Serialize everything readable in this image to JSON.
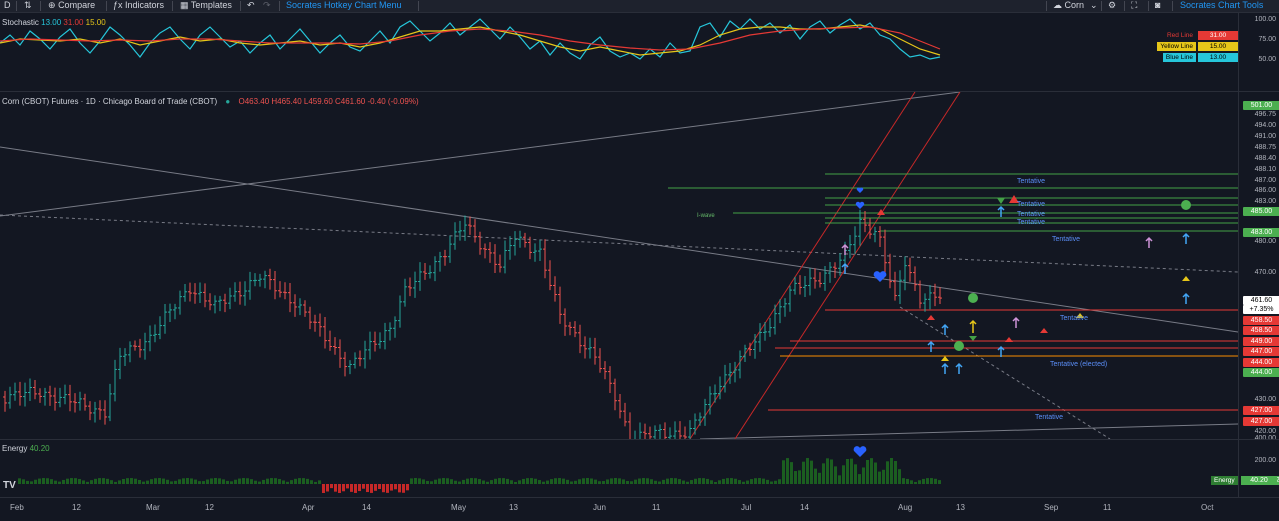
{
  "toolbar": {
    "symbol_partial": "D",
    "compare": "Compare",
    "indicators": "Indicators",
    "templates": "Templates",
    "hotkey_menu": "Socrates Hotkey Chart Menu",
    "symbol": "Corn",
    "chart_tools": "Socrates Chart Tools"
  },
  "stochastic": {
    "name": "Stochastic",
    "v1": "13.00",
    "v2": "31.00",
    "v3": "15.00",
    "axis": [
      "100.00",
      "75.00",
      "50.00"
    ],
    "legend": [
      {
        "label": "Red Line",
        "value": "31.00"
      },
      {
        "label": "Yellow Line",
        "value": "15.00"
      },
      {
        "label": "Blue Line",
        "value": "13.00"
      }
    ],
    "colors": {
      "red": "#e53935",
      "yellow": "#e6c619",
      "blue": "#26c6da"
    }
  },
  "main": {
    "title": "Corn (CBOT) Futures · 1D · Chicago Board of Trade (CBOT)",
    "ohlc": "O463.40 H465.40 L459.60 C461.60 -0.40 (-0.09%)",
    "labels": {
      "iwave": "I-wave",
      "tentative1": "Tentative",
      "tentative2": "Tentative",
      "tentative3": "Tentative",
      "tentative4": "Tentative",
      "tentative5": "Tentative",
      "tentative_elected": "Tentative (elected)",
      "tentative6": "Tentative"
    }
  },
  "price_axis": {
    "green_tags": [
      "501.00",
      "485.00",
      "483.00",
      "444.00"
    ],
    "red_tags": [
      "458.50",
      "458.50",
      "449.00",
      "447.00",
      "444.00",
      "427.00",
      "427.00"
    ],
    "current": "461.60",
    "current_pct": "+7.35%",
    "plain": [
      "496.75",
      "494.00",
      "491.00",
      "488.75",
      "488.40",
      "488.10",
      "487.00",
      "486.00",
      "483.00",
      "480.00",
      "470.00",
      "430.00",
      "420.00",
      "400.00"
    ]
  },
  "energy": {
    "name": "Energy",
    "value": "40.20",
    "axis": "200.00",
    "tag_label": "Energy",
    "tag_value": "40.20"
  },
  "time_axis": [
    "Feb",
    "12",
    "Mar",
    "12",
    "Apr",
    "14",
    "May",
    "13",
    "Jun",
    "11",
    "Jul",
    "14",
    "Aug",
    "13",
    "Sep",
    "11",
    "Oct"
  ]
}
